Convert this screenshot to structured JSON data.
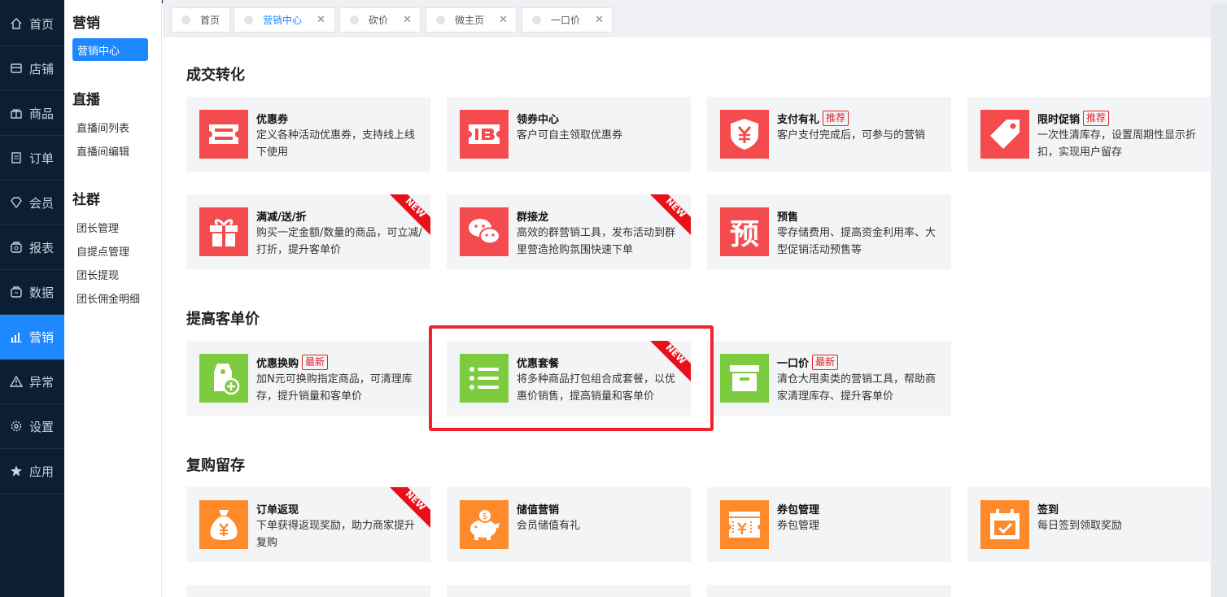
{
  "nav": [
    {
      "label": "首页",
      "icon": "home-icon"
    },
    {
      "label": "店铺",
      "icon": "store-icon"
    },
    {
      "label": "商品",
      "icon": "gift-icon"
    },
    {
      "label": "订单",
      "icon": "order-icon"
    },
    {
      "label": "会员",
      "icon": "diamond-icon"
    },
    {
      "label": "报表",
      "icon": "report-icon"
    },
    {
      "label": "数据",
      "icon": "data-icon"
    },
    {
      "label": "营销",
      "icon": "chart-icon"
    },
    {
      "label": "异常",
      "icon": "warning-icon"
    },
    {
      "label": "设置",
      "icon": "gear-icon"
    },
    {
      "label": "应用",
      "icon": "star-icon"
    }
  ],
  "submenu": {
    "marketing_title": "营销",
    "marketing_center": "营销中心",
    "live_title": "直播",
    "live_items": [
      "直播间列表",
      "直播间编辑"
    ],
    "community_title": "社群",
    "community_items": [
      "团长管理",
      "自提点管理",
      "团长提现",
      "团长佣金明细"
    ]
  },
  "tabs": [
    {
      "label": "首页",
      "closable": false
    },
    {
      "label": "营销中心",
      "closable": true,
      "active": true
    },
    {
      "label": "砍价",
      "closable": true
    },
    {
      "label": "微主页",
      "closable": true
    },
    {
      "label": "一口价",
      "closable": true
    }
  ],
  "tab_close_glyph": "✕",
  "badges": {
    "recommend": "推荐",
    "newest": "最新"
  },
  "sections": [
    {
      "title": "成交转化",
      "cards": [
        {
          "title": "优惠券",
          "desc": "定义各种活动优惠券，支持线上线下使用",
          "color": "#f44b4f",
          "icon": "coupon-icon"
        },
        {
          "title": "领券中心",
          "desc": "客户可自主领取优惠券",
          "color": "#f44b4f",
          "icon": "ticket-icon"
        },
        {
          "title": "支付有礼",
          "badge": "推荐",
          "desc": "客户支付完成后，可参与的营销",
          "color": "#f44b4f",
          "icon": "yen-shield-icon"
        },
        {
          "title": "限时促销",
          "badge": "推荐",
          "desc": "一次性清库存，设置周期性显示折扣，实现用户留存",
          "color": "#f44b4f",
          "icon": "price-tag-icon"
        },
        {
          "title": "满减/送/折",
          "desc": "购买一定金额/数量的商品，可立减/打折，提升客单价",
          "color": "#f44b4f",
          "icon": "gift-box-icon",
          "new": true
        },
        {
          "title": "群接龙",
          "desc": "高效的群营销工具，发布活动到群里营造抢购氛围快速下单",
          "color": "#f44b4f",
          "icon": "wechat-icon",
          "new": true
        },
        {
          "title": "预售",
          "desc": "零存储费用、提高资金利用率、大型促销活动预售等",
          "color": "#f44b4f",
          "icon": "presale-icon",
          "icon_text": "预"
        }
      ]
    },
    {
      "title": "提高客单价",
      "cards": [
        {
          "title": "优惠换购",
          "badge": "最新",
          "desc": "加N元可换购指定商品，可清理库存，提升销量和客单价",
          "color": "#7dcb3e",
          "icon": "tag-plus-icon"
        },
        {
          "title": "优惠套餐",
          "desc": "将多种商品打包组合成套餐，以优惠价销售，提高销量和客单价",
          "color": "#7dcb3e",
          "icon": "list-icon",
          "new": true
        },
        {
          "title": "一口价",
          "badge": "最新",
          "desc": "清仓大甩卖类的营销工具，帮助商家清理库存、提升客单价",
          "color": "#7dcb3e",
          "icon": "box-icon"
        }
      ]
    },
    {
      "title": "复购留存",
      "cards": [
        {
          "title": "订单返现",
          "desc": "下单获得返现奖励，助力商家提升复购",
          "color": "#ff8a2b",
          "icon": "money-bag-icon",
          "new": true
        },
        {
          "title": "储值营销",
          "desc": "会员储值有礼",
          "color": "#ff8a2b",
          "icon": "piggy-bank-icon"
        },
        {
          "title": "券包管理",
          "desc": "券包管理",
          "color": "#ff8a2b",
          "icon": "coupon-pack-icon"
        },
        {
          "title": "签到",
          "desc": "每日签到领取奖励",
          "color": "#ff8a2b",
          "icon": "calendar-check-icon"
        }
      ]
    }
  ],
  "ribbon_text": "NEW",
  "colors": {
    "accent": "#1e88ff",
    "nav_bg": "#0b1e33",
    "highlight": "#f4222a"
  }
}
